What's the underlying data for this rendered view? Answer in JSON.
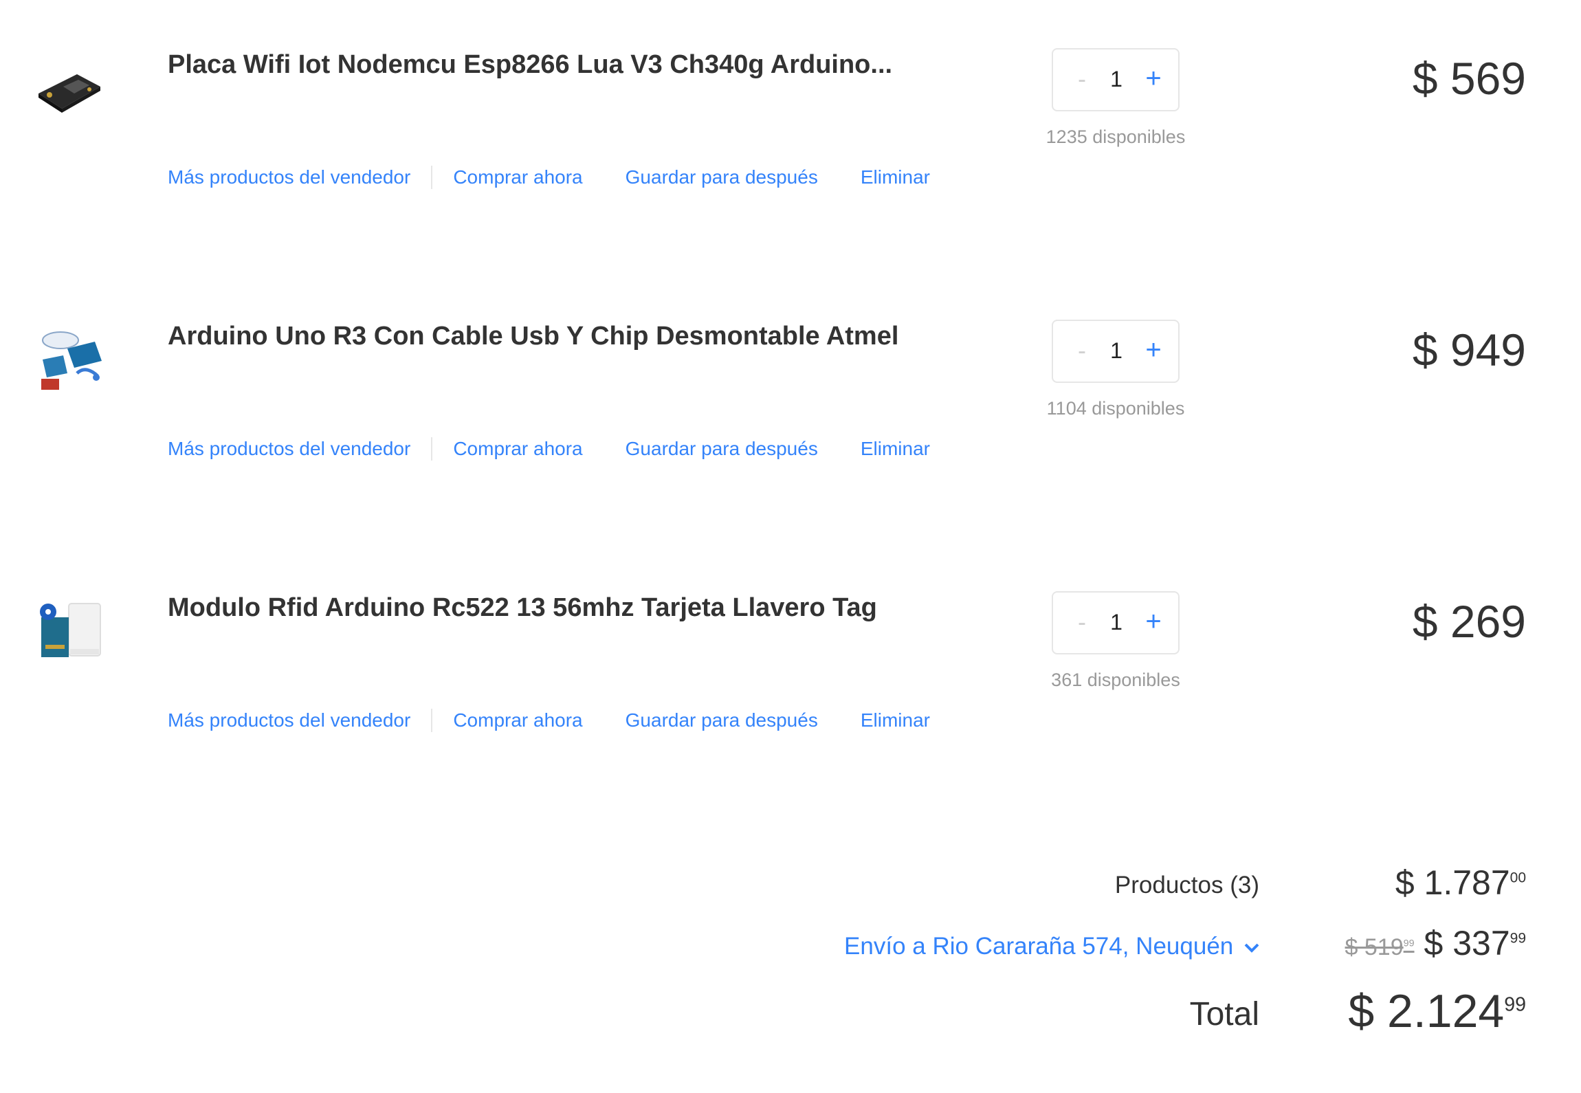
{
  "items": [
    {
      "title": "Placa Wifi Iot Nodemcu Esp8266 Lua V3 Ch340g Arduino...",
      "quantity": "1",
      "minus": "-",
      "plus": "+",
      "stock": "1235 disponibles",
      "price": "$ 569",
      "actions": {
        "more": "Más productos del vendedor",
        "buy": "Comprar ahora",
        "save": "Guardar para después",
        "delete": "Eliminar"
      }
    },
    {
      "title": "Arduino Uno R3 Con Cable Usb Y Chip Desmontable Atmel",
      "quantity": "1",
      "minus": "-",
      "plus": "+",
      "stock": "1104 disponibles",
      "price": "$ 949",
      "actions": {
        "more": "Más productos del vendedor",
        "buy": "Comprar ahora",
        "save": "Guardar para después",
        "delete": "Eliminar"
      }
    },
    {
      "title": "Modulo Rfid Arduino Rc522 13 56mhz Tarjeta Llavero Tag",
      "quantity": "1",
      "minus": "-",
      "plus": "+",
      "stock": "361 disponibles",
      "price": "$ 269",
      "actions": {
        "more": "Más productos del vendedor",
        "buy": "Comprar ahora",
        "save": "Guardar para después",
        "delete": "Eliminar"
      }
    }
  ],
  "summary": {
    "products_label": "Productos (3)",
    "products_price": "$ 1.787",
    "products_cents": "00",
    "shipping_label": "Envío a Rio Cararaña 574, Neuquén",
    "shipping_old_price": "$ 519",
    "shipping_old_cents": "99",
    "shipping_price": "$ 337",
    "shipping_cents": "99",
    "total_label": "Total",
    "total_price": "$ 2.124",
    "total_cents": "99"
  },
  "colors": {
    "link": "#3483fa",
    "text": "#333333",
    "muted": "#999999",
    "border": "#e6e6e6"
  }
}
